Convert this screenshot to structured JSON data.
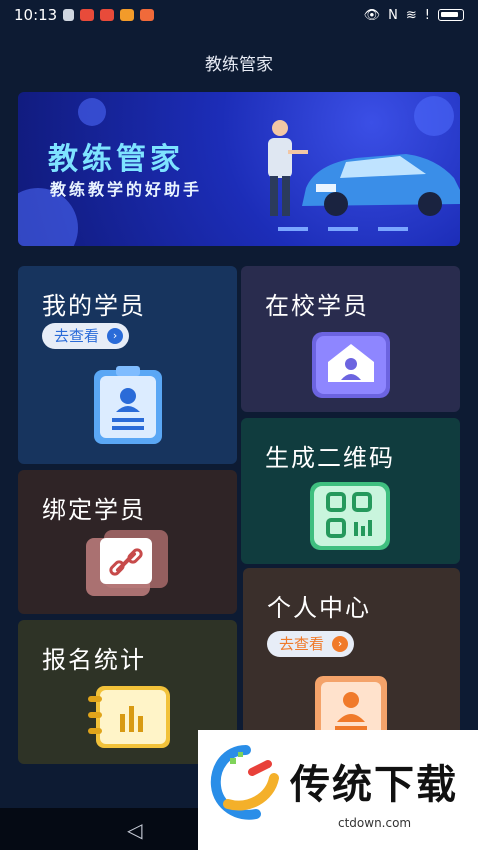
{
  "status_bar": {
    "time": "10:13"
  },
  "app": {
    "title": "教练管家"
  },
  "banner": {
    "title": "教练管家",
    "subtitle": "教练教学的好助手"
  },
  "cards": {
    "students": {
      "title": "我的学员",
      "action": "去查看"
    },
    "school_students": {
      "title": "在校学员"
    },
    "qrcode": {
      "title": "生成二维码"
    },
    "bind": {
      "title": "绑定学员"
    },
    "stats": {
      "title": "报名统计"
    },
    "personal": {
      "title": "个人中心",
      "action": "去查看"
    }
  },
  "watermark": {
    "text": "传统下载",
    "url": "ctdown.com"
  },
  "colors": {
    "background": "#0d1b33",
    "pill_text": "#2a6bd8",
    "personal_accent": "#f07a2a"
  }
}
